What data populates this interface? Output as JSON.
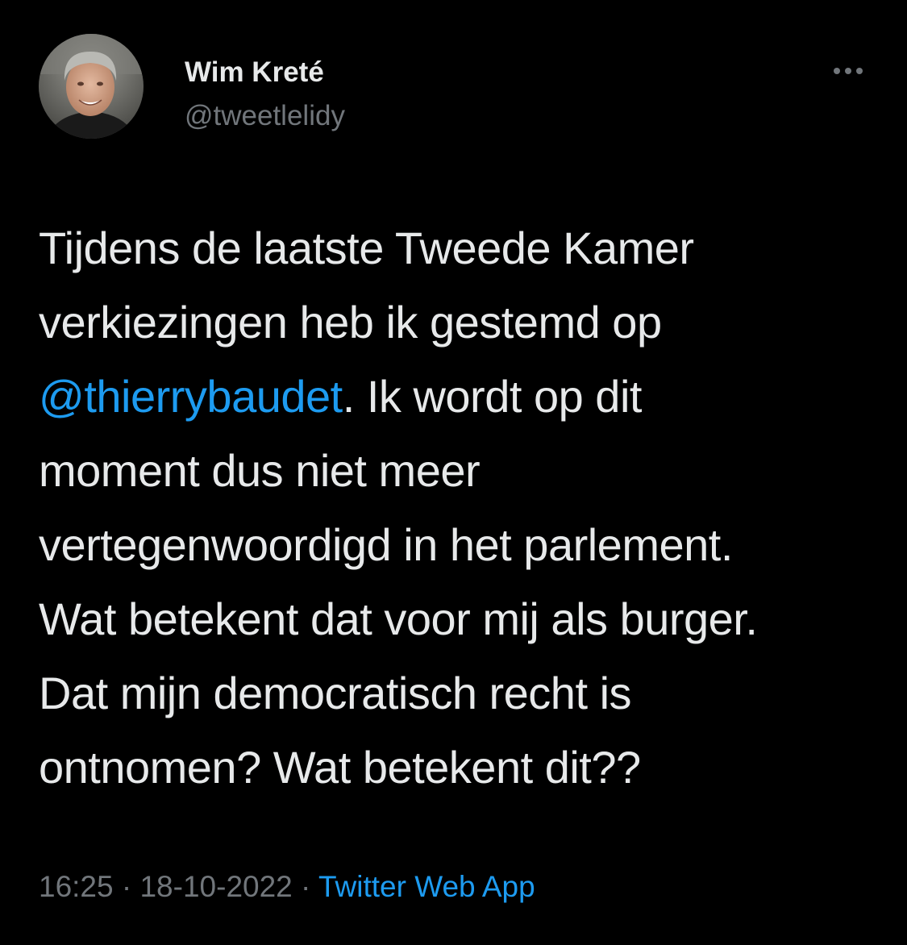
{
  "author": {
    "display_name": "Wim Kreté",
    "handle": "@tweetlelidy"
  },
  "tweet": {
    "line1": "Tijdens de laatste Tweede Kamer",
    "line2": "verkiezingen heb ik gestemd op",
    "mention": "@thierrybaudet",
    "line3_rest": ". Ik wordt op dit",
    "line4": "moment dus niet meer",
    "line5": "vertegenwoordigd in het parlement.",
    "line6": "Wat betekent dat voor mij als burger.",
    "line7": "Dat mijn democratisch recht is",
    "line8": "ontnomen? Wat betekent dit??"
  },
  "meta": {
    "time": "16:25",
    "separator1": " · ",
    "date": "18-10-2022",
    "separator2": " · ",
    "source": "Twitter Web App"
  },
  "icons": {
    "more": "more-horizontal-icon",
    "avatar": "profile-photo"
  },
  "colors": {
    "background": "#000000",
    "text_primary": "#e7e9ea",
    "text_secondary": "#71767b",
    "accent": "#1d9bf0"
  }
}
